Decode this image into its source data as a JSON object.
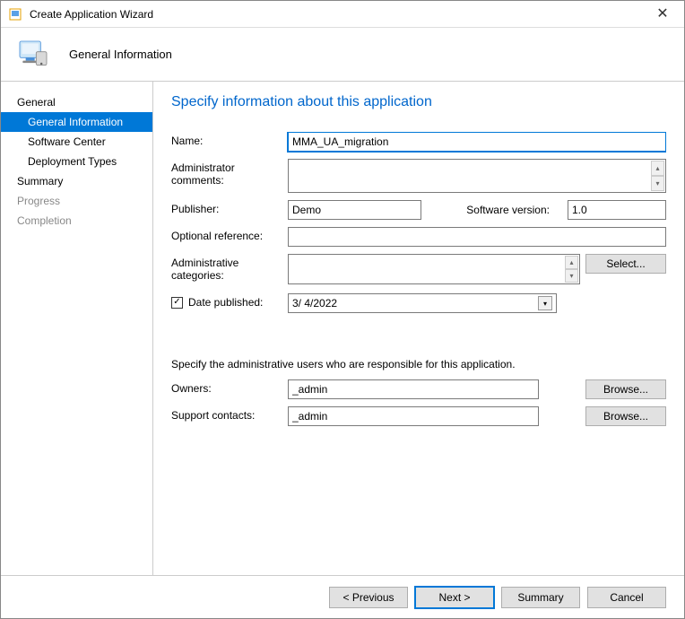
{
  "window": {
    "title": "Create Application Wizard"
  },
  "header": {
    "step_title": "General Information"
  },
  "sidebar": {
    "groups": [
      {
        "label": "General",
        "active": true
      },
      {
        "label": "Summary",
        "active": true
      },
      {
        "label": "Progress",
        "active": false
      },
      {
        "label": "Completion",
        "active": false
      }
    ],
    "items": [
      {
        "label": "General Information",
        "selected": true
      },
      {
        "label": "Software Center",
        "selected": false
      },
      {
        "label": "Deployment Types",
        "selected": false
      }
    ]
  },
  "main": {
    "title": "Specify information about this application",
    "labels": {
      "name": "Name:",
      "admin_comments": "Administrator comments:",
      "publisher": "Publisher:",
      "software_version": "Software version:",
      "optional_reference": "Optional reference:",
      "admin_categories": "Administrative categories:",
      "date_published": "Date published:",
      "instruction": "Specify the administrative users who are responsible for this application.",
      "owners": "Owners:",
      "support_contacts": "Support contacts:"
    },
    "values": {
      "name": "MMA_UA_migration",
      "admin_comments": "",
      "publisher": "Demo",
      "software_version": "1.0",
      "optional_reference": "",
      "admin_categories": "",
      "date_published_checked": "✓",
      "date_published": "3/  4/2022",
      "owners": "_admin",
      "support_contacts": "_admin"
    },
    "buttons": {
      "select": "Select...",
      "browse": "Browse..."
    }
  },
  "footer": {
    "previous": "< Previous",
    "next": "Next >",
    "summary": "Summary",
    "cancel": "Cancel"
  }
}
